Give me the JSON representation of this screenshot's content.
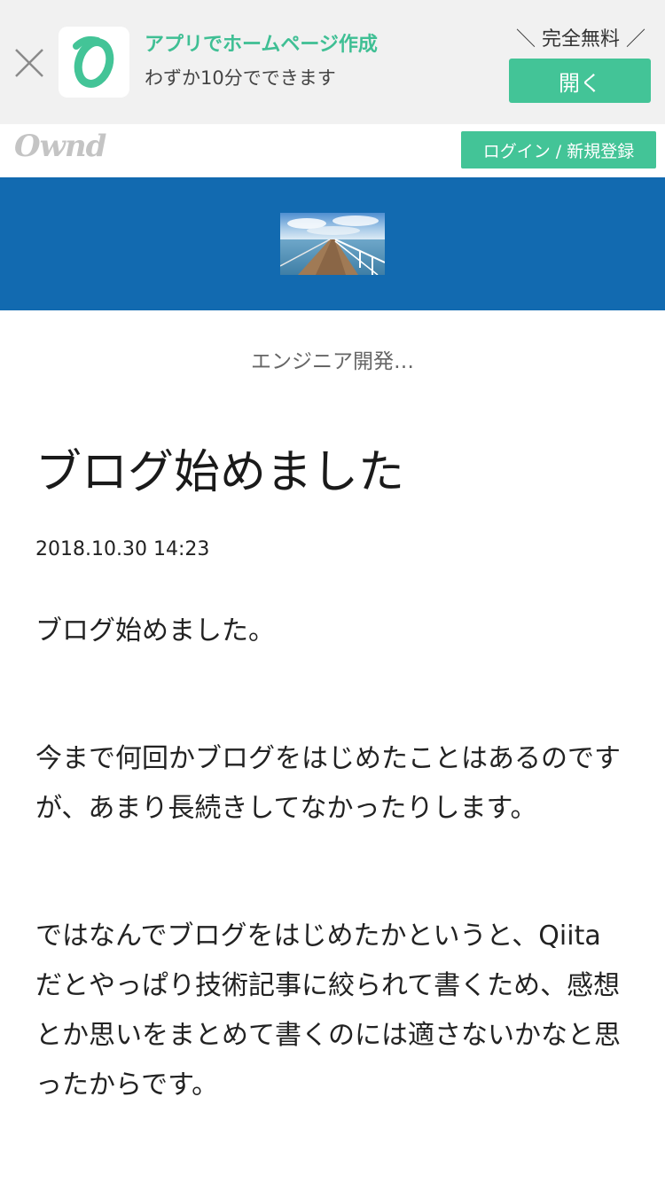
{
  "app_banner": {
    "title": "アプリでホームページ作成",
    "subtitle": "わずか10分でできます",
    "badge": "＼ 完全無料 ／",
    "open_label": "開く",
    "close_icon": "close-icon",
    "app_icon": "owned-app-icon",
    "accent_color": "#43c497"
  },
  "header": {
    "logo_text": "Ownd",
    "login_label": "ログイン / 新規登録"
  },
  "hero": {
    "background_color": "#126ab0",
    "image": "pier-image"
  },
  "blog": {
    "name": "エンジニア開発…"
  },
  "article": {
    "title": "ブログ始めました",
    "date": "2018.10.30 14:23",
    "paragraphs": [
      "ブログ始めました。",
      "今まで何回かブログをはじめたことはあるのですが、あまり長続きしてなかったりします。",
      "ではなんでブログをはじめたかというと、Qiitaだとやっぱり技術記事に絞られて書くため、感想とか思いをまとめて書くのには適さないかなと思ったからです。"
    ]
  }
}
